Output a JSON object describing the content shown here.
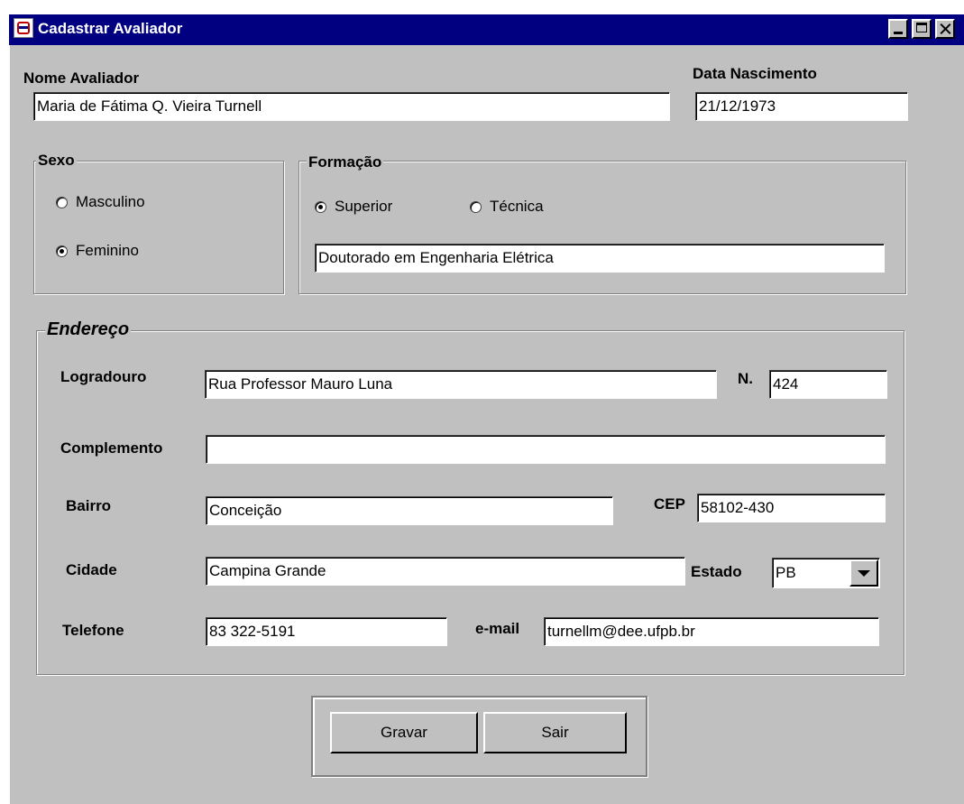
{
  "window": {
    "title": "Cadastrar Avaliador"
  },
  "nome": {
    "label": "Nome Avaliador",
    "value": "Maria de Fátima Q. Vieira Turnell"
  },
  "data_nascimento": {
    "label": "Data Nascimento",
    "value": "21/12/1973"
  },
  "sexo": {
    "legend": "Sexo",
    "options": [
      {
        "label": "Masculino",
        "selected": false
      },
      {
        "label": "Feminino",
        "selected": true
      }
    ]
  },
  "formacao": {
    "legend": "Formação",
    "options": [
      {
        "label": "Superior",
        "selected": true
      },
      {
        "label": "Técnica",
        "selected": false
      }
    ],
    "value": "Doutorado em Engenharia Elétrica"
  },
  "endereco": {
    "legend": "Endereço",
    "logradouro": {
      "label": "Logradouro",
      "value": "Rua Professor Mauro Luna"
    },
    "numero": {
      "label": "N.",
      "value": "424"
    },
    "complemento": {
      "label": "Complemento",
      "value": ""
    },
    "bairro": {
      "label": "Bairro",
      "value": "Conceição"
    },
    "cep": {
      "label": "CEP",
      "value": "58102-430"
    },
    "cidade": {
      "label": "Cidade",
      "value": "Campina Grande"
    },
    "estado": {
      "label": "Estado",
      "value": "PB"
    },
    "telefone": {
      "label": "Telefone",
      "value": "83 322-5191"
    },
    "email": {
      "label": "e-mail",
      "value": "turnellm@dee.ufpb.br"
    }
  },
  "buttons": {
    "gravar": "Gravar",
    "sair": "Sair"
  }
}
